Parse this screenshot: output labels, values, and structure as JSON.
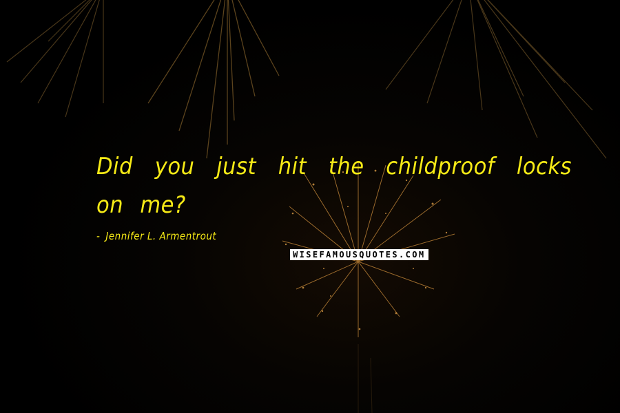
{
  "quote": {
    "text": "Did you just hit the childproof locks on me?"
  },
  "author": {
    "dash": "-",
    "name": "Jennifer L. Armentrout"
  },
  "watermark": "WISEFAMOUSQUOTES.COM",
  "colors": {
    "text": "#f6ea16",
    "background": "#000000",
    "firework": "#c98b3a"
  }
}
